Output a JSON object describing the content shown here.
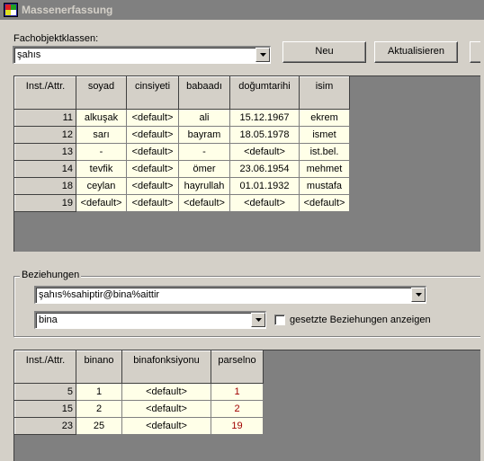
{
  "window": {
    "title": "Massenerfassung"
  },
  "class_select": {
    "label": "Fachobjektklassen:",
    "value": "şahıs"
  },
  "buttons": {
    "new": "Neu",
    "refresh": "Aktualisieren"
  },
  "upper_table": {
    "columns": [
      "Inst./Attr.",
      "soyad",
      "cinsiyeti",
      "babaadı",
      "doğumtarihi",
      "isim"
    ],
    "rows": [
      [
        "11",
        "alkuşak",
        "<default>",
        "ali",
        "15.12.1967",
        "ekrem"
      ],
      [
        "12",
        "sarı",
        "<default>",
        "bayram",
        "18.05.1978",
        "ismet"
      ],
      [
        "13",
        "-",
        "<default>",
        "-",
        "<default>",
        "ist.bel."
      ],
      [
        "14",
        "tevfik",
        "<default>",
        "ömer",
        "23.06.1954",
        "mehmet"
      ],
      [
        "18",
        "ceylan",
        "<default>",
        "hayrullah",
        "01.01.1932",
        "mustafa"
      ],
      [
        "19",
        "<default>",
        "<default>",
        "<default>",
        "<default>",
        "<default>"
      ]
    ]
  },
  "relations": {
    "legend": "Beziehungen",
    "relation_select": "şahıs%sahiptir@bina%aittir",
    "target_select": "bina",
    "show_set_checkbox_label": "gesetzte Beziehungen anzeigen",
    "show_set_checked": false
  },
  "lower_table": {
    "columns": [
      "Inst./Attr.",
      "binano",
      "binafonksiyonu",
      "parselno"
    ],
    "rows": [
      [
        "5",
        "1",
        "<default>",
        "1"
      ],
      [
        "15",
        "2",
        "<default>",
        "2"
      ],
      [
        "23",
        "25",
        "<default>",
        "19"
      ]
    ]
  },
  "colors": {
    "titlebar": "#808080",
    "cell_bg": "#ffffe8",
    "grid_bg": "#808080",
    "accent_red": "#a00000"
  },
  "icons": {
    "app": "app-icon",
    "dropdown": "dropdown-arrow-icon"
  }
}
